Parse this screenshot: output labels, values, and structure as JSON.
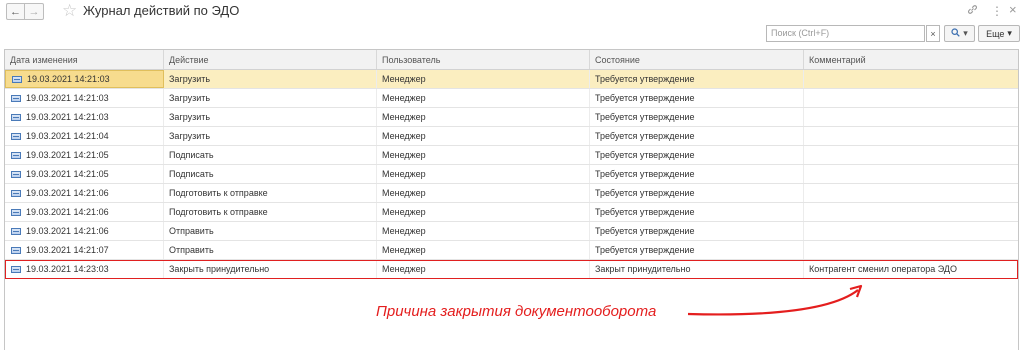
{
  "window": {
    "title": "Журнал действий по ЭДО",
    "back_glyph": "←",
    "forward_glyph": "→",
    "star_glyph": "☆",
    "link_glyph": "🔗",
    "menu_glyph": "⋮",
    "close_glyph": "×"
  },
  "toolbar": {
    "search_placeholder": "Поиск (Ctrl+F)",
    "clear_glyph": "×",
    "search_glyph": "🔍",
    "dropdown_glyph": "▾",
    "more_label": "Еще"
  },
  "table": {
    "columns": [
      "Дата изменения",
      "Действие",
      "Пользователь",
      "Состояние",
      "Комментарий"
    ],
    "rows": [
      {
        "date": "19.03.2021 14:21:03",
        "action": "Загрузить",
        "user": "Менеджер",
        "state": "Требуется утверждение",
        "comment": ""
      },
      {
        "date": "19.03.2021 14:21:03",
        "action": "Загрузить",
        "user": "Менеджер",
        "state": "Требуется утверждение",
        "comment": ""
      },
      {
        "date": "19.03.2021 14:21:03",
        "action": "Загрузить",
        "user": "Менеджер",
        "state": "Требуется утверждение",
        "comment": ""
      },
      {
        "date": "19.03.2021 14:21:04",
        "action": "Загрузить",
        "user": "Менеджер",
        "state": "Требуется утверждение",
        "comment": ""
      },
      {
        "date": "19.03.2021 14:21:05",
        "action": "Подписать",
        "user": "Менеджер",
        "state": "Требуется утверждение",
        "comment": ""
      },
      {
        "date": "19.03.2021 14:21:05",
        "action": "Подписать",
        "user": "Менеджер",
        "state": "Требуется утверждение",
        "comment": ""
      },
      {
        "date": "19.03.2021 14:21:06",
        "action": "Подготовить к отправке",
        "user": "Менеджер",
        "state": "Требуется утверждение",
        "comment": ""
      },
      {
        "date": "19.03.2021 14:21:06",
        "action": "Подготовить к отправке",
        "user": "Менеджер",
        "state": "Требуется утверждение",
        "comment": ""
      },
      {
        "date": "19.03.2021 14:21:06",
        "action": "Отправить",
        "user": "Менеджер",
        "state": "Требуется утверждение",
        "comment": ""
      },
      {
        "date": "19.03.2021 14:21:07",
        "action": "Отправить",
        "user": "Менеджер",
        "state": "Требуется утверждение",
        "comment": ""
      },
      {
        "date": "19.03.2021 14:23:03",
        "action": "Закрыть принудительно",
        "user": "Менеджер",
        "state": "Закрыт принудительно",
        "comment": "Контрагент сменил оператора ЭДО"
      }
    ]
  },
  "annotation": {
    "text": "Причина закрытия документооборота",
    "color": "#e41e1e"
  },
  "colors": {
    "selected_row": "#fbeec0",
    "highlight_border": "#e02020"
  }
}
